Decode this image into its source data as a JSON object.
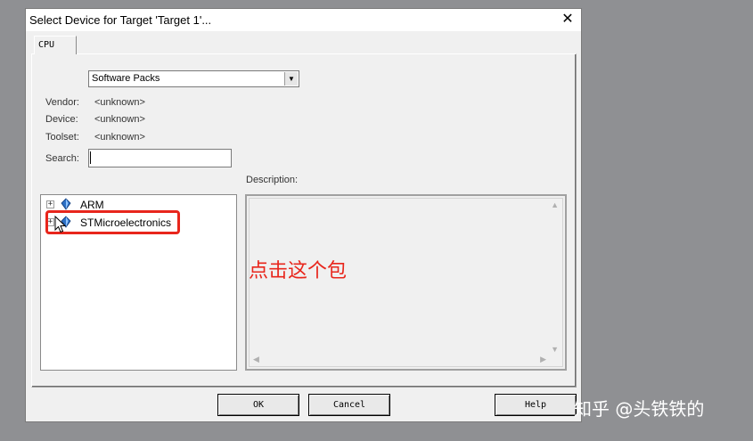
{
  "window": {
    "title": "Select Device for Target 'Target 1'...",
    "close_glyph": "✕"
  },
  "tab": {
    "label": "CPU"
  },
  "source_select": {
    "selected": "Software Packs"
  },
  "fields": {
    "vendor_label": "Vendor:",
    "vendor_value": "<unknown>",
    "device_label": "Device:",
    "device_value": "<unknown>",
    "toolset_label": "Toolset:",
    "toolset_value": "<unknown>",
    "search_label": "Search:",
    "search_value": ""
  },
  "tree": {
    "items": [
      {
        "label": "ARM",
        "expander": "+"
      },
      {
        "label": "STMicroelectronics",
        "expander": "+"
      }
    ]
  },
  "description": {
    "label": "Description:"
  },
  "annotation": {
    "text": "点击这个包",
    "color": "#e8261c"
  },
  "buttons": {
    "ok": "OK",
    "cancel": "Cancel",
    "help": "Help"
  },
  "watermark": {
    "text": "知乎 @头铁铁的"
  }
}
